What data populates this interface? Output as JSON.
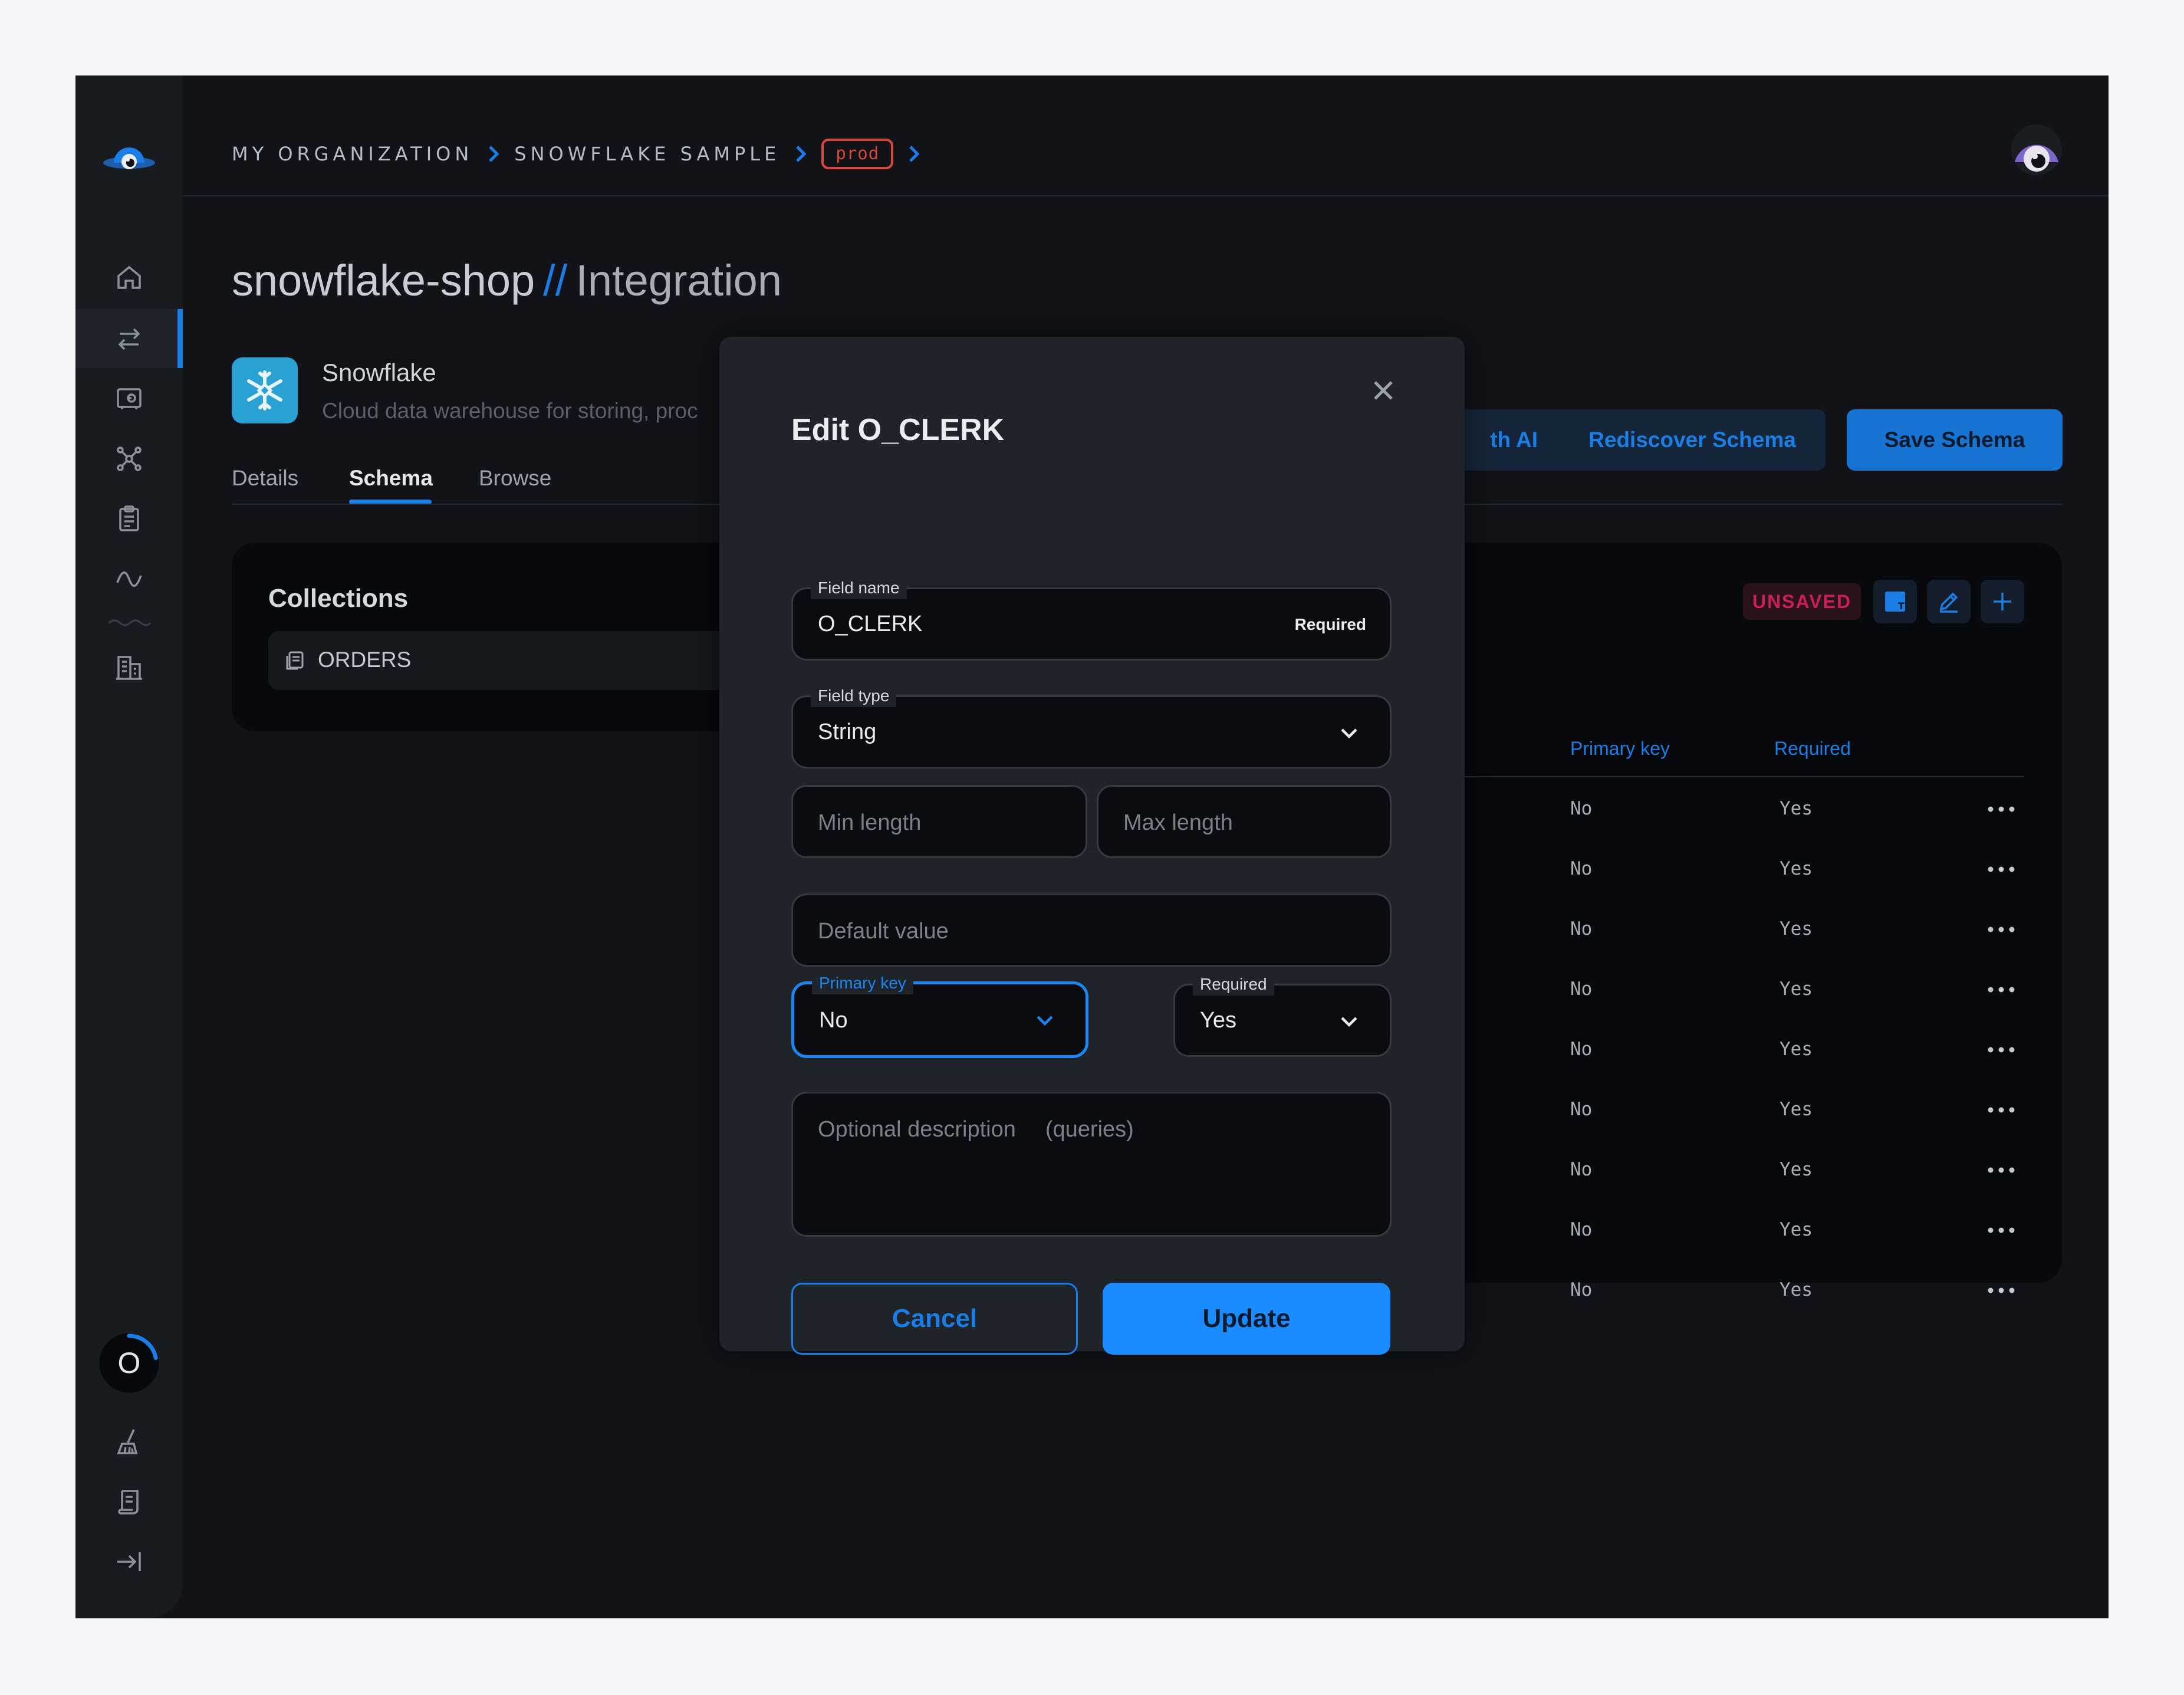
{
  "breadcrumb": {
    "org": "MY ORGANIZATION",
    "project": "SNOWFLAKE SAMPLE",
    "env": "prod"
  },
  "page": {
    "title": "snowflake-shop",
    "separator": "//",
    "subtitle": "Integration"
  },
  "connector": {
    "name": "Snowflake",
    "description": "Cloud data warehouse for storing, proc"
  },
  "tabs": [
    {
      "label": "Details"
    },
    {
      "label": "Schema"
    },
    {
      "label": "Browse"
    }
  ],
  "actions": {
    "ai_label": "th AI",
    "rediscover_label": "Rediscover Schema",
    "save_label": "Save Schema"
  },
  "collections": {
    "title": "Collections",
    "items": [
      {
        "label": "ORDERS"
      }
    ]
  },
  "fields_panel": {
    "unsaved_label": "UNSAVED",
    "columns": {
      "primary_key": "Primary key",
      "required": "Required"
    },
    "rows": [
      {
        "primary_key": "No",
        "required": "Yes"
      },
      {
        "primary_key": "No",
        "required": "Yes"
      },
      {
        "primary_key": "No",
        "required": "Yes"
      },
      {
        "primary_key": "No",
        "required": "Yes"
      },
      {
        "primary_key": "No",
        "required": "Yes"
      },
      {
        "primary_key": "No",
        "required": "Yes"
      },
      {
        "primary_key": "No",
        "required": "Yes"
      },
      {
        "primary_key": "No",
        "required": "Yes"
      },
      {
        "primary_key": "No",
        "required": "Yes"
      }
    ]
  },
  "sidebar": {
    "progress_label": "O",
    "progress_fraction": 0.22
  },
  "modal": {
    "title": "Edit O_CLERK",
    "field_name": {
      "label": "Field name",
      "value": "O_CLERK",
      "tag": "Required"
    },
    "field_type": {
      "label": "Field type",
      "value": "String"
    },
    "min_length": {
      "placeholder": "Min length"
    },
    "max_length": {
      "placeholder": "Max length"
    },
    "default_value": {
      "placeholder": "Default value"
    },
    "primary_key": {
      "label": "Primary key",
      "value": "No"
    },
    "required": {
      "label": "Required",
      "value": "Yes"
    },
    "description": {
      "placeholder": "Optional description",
      "hint": "(queries)"
    },
    "cancel_label": "Cancel",
    "update_label": "Update"
  },
  "colors": {
    "accent": "#1b7ee6",
    "update_button": "#1a8cff",
    "env_badge": "#d9473b",
    "unsaved": "#cc1f55",
    "snowflake_brand": "#2aa1d3"
  }
}
